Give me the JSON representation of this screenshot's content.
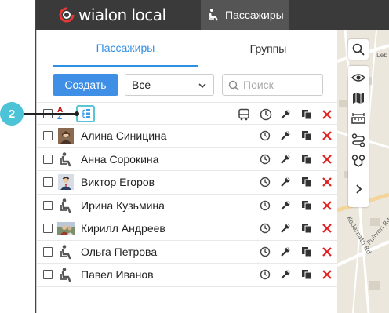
{
  "topbar": {
    "logo_text": "wialon local",
    "active_tab_label": "Пассажиры"
  },
  "tabs": [
    {
      "label": "Пассажиры",
      "active": true
    },
    {
      "label": "Группы",
      "active": false
    }
  ],
  "toolbar": {
    "create_label": "Создать",
    "filter_value": "Все",
    "search_placeholder": "Поиск"
  },
  "header": {
    "sort_a": "A",
    "sort_z": "Z"
  },
  "passengers": [
    {
      "name": "Алина Синицина",
      "avatar": "photo"
    },
    {
      "name": "Анна Сорокина",
      "avatar": "passenger-icon"
    },
    {
      "name": "Виктор Егоров",
      "avatar": "photo"
    },
    {
      "name": "Ирина Кузьмина",
      "avatar": "passenger-icon"
    },
    {
      "name": "Кирилл Андреев",
      "avatar": "photo"
    },
    {
      "name": "Ольга Петрова",
      "avatar": "passenger-icon"
    },
    {
      "name": "Павел Иванов",
      "avatar": "passenger-icon"
    }
  ],
  "callout": {
    "number": "2"
  },
  "colors": {
    "accent": "#2f8fe3",
    "create_button": "#3f8fe6",
    "delete": "#e02020",
    "callout": "#4cc3d6",
    "topbar": "#3a3a3a"
  },
  "map": {
    "labels": [
      "Leb",
      "Kedarnath Rd",
      "Pulivon Rd"
    ]
  }
}
